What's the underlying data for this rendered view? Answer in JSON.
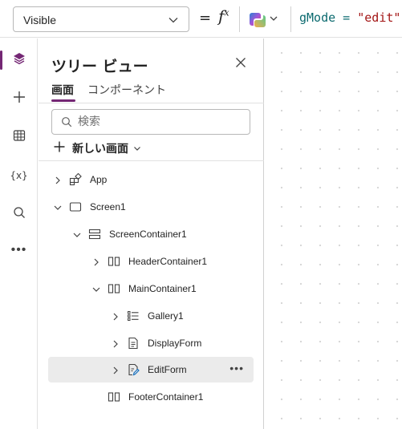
{
  "formula_bar": {
    "property": "Visible",
    "equals": "=",
    "fx": "fx",
    "code_var": "gMode",
    "code_op": " = ",
    "code_str": "\"edit\""
  },
  "rail": {
    "items": [
      {
        "name": "tree-view",
        "icon": "layers-icon",
        "active": true
      },
      {
        "name": "insert",
        "icon": "plus-icon"
      },
      {
        "name": "data",
        "icon": "table-icon"
      },
      {
        "name": "variables",
        "icon": "variables-icon",
        "text": "{x}"
      },
      {
        "name": "search",
        "icon": "search-icon"
      },
      {
        "name": "more",
        "icon": "more-icon",
        "text": "•••"
      }
    ]
  },
  "panel": {
    "title": "ツリー ビュー",
    "tabs": [
      "画面",
      "コンポーネント"
    ],
    "search_placeholder": "検索",
    "new_screen_label": "新しい画面"
  },
  "tree": [
    {
      "label": "App",
      "icon": "app-icon",
      "expanded": false
    },
    {
      "label": "Screen1",
      "icon": "screen-icon",
      "expanded": true
    },
    {
      "label": "ScreenContainer1",
      "icon": "vertical-container-icon",
      "expanded": true
    },
    {
      "label": "HeaderContainer1",
      "icon": "horizontal-container-icon",
      "expanded": false
    },
    {
      "label": "MainContainer1",
      "icon": "horizontal-container-icon",
      "expanded": true
    },
    {
      "label": "Gallery1",
      "icon": "gallery-icon",
      "expanded": false
    },
    {
      "label": "DisplayForm",
      "icon": "display-form-icon",
      "expanded": false
    },
    {
      "label": "EditForm",
      "icon": "edit-form-icon",
      "expanded": false,
      "selected": true,
      "more": "•••"
    },
    {
      "label": "FooterContainer1",
      "icon": "horizontal-container-icon"
    }
  ],
  "colors": {
    "accent": "#742774",
    "selected_row": "#ebebeb",
    "code_var": "#0b6a6f",
    "code_string": "#a31515"
  }
}
